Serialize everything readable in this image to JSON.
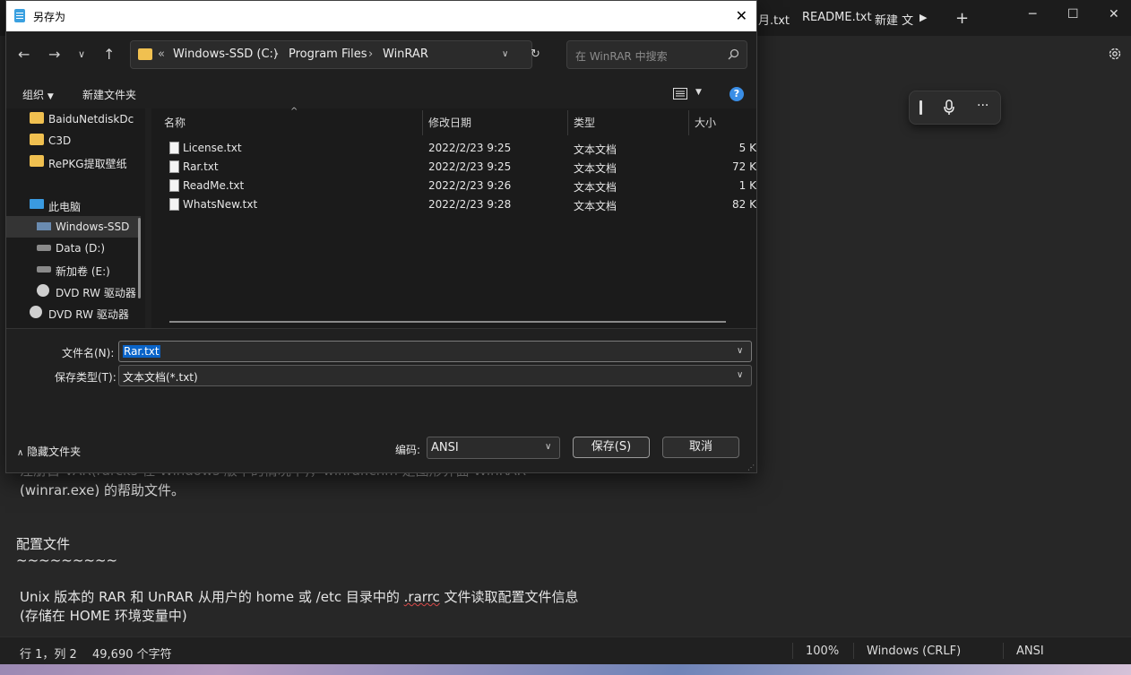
{
  "notepad": {
    "tabs": [
      "月.txt",
      "README.txt",
      "新建 文"
    ],
    "content": {
      "line1": "注册自 VAR(rarcks 在 Windows 版中的情况下)，winrar.chm 是图形界面 WinRAR",
      "line2": "(winrar.exe) 的帮助文件。",
      "heading": "配置文件",
      "tildes": "~~~~~~~~~",
      "line3a": "Unix 版本的 RAR 和 UnRAR 从用户的 home 或 /etc 目录中的 ",
      "line3b": ".rarrc",
      "line3c": " 文件读取配置文件信息",
      "line4": "(存储在 HOME 环境变量中)"
    },
    "status": {
      "position": "行 1，列 2",
      "chars": "49,690 个字符",
      "zoom": "100%",
      "line_ending": "Windows (CRLF)",
      "encoding": "ANSI"
    }
  },
  "dialog": {
    "title": "另存为",
    "breadcrumb": {
      "overflow": "«",
      "parts": [
        "Windows-SSD (C:)",
        "Program Files",
        "WinRAR"
      ]
    },
    "search_placeholder": "在 WinRAR 中搜索",
    "toolbar": {
      "organize": "组织",
      "new_folder": "新建文件夹"
    },
    "tree": [
      {
        "label": "BaiduNetdiskDc",
        "icon": "folder-icon"
      },
      {
        "label": "C3D",
        "icon": "folder-icon"
      },
      {
        "label": "RePKG提取壁纸",
        "icon": "folder-icon"
      },
      {
        "label": "此电脑",
        "icon": "computer-icon"
      },
      {
        "label": "Windows-SSD",
        "icon": "drive-icon"
      },
      {
        "label": "Data (D:)",
        "icon": "drive-icon"
      },
      {
        "label": "新加卷 (E:)",
        "icon": "drive-icon"
      },
      {
        "label": "DVD RW 驱动器",
        "icon": "dvd-icon"
      },
      {
        "label": "DVD RW 驱动器",
        "icon": "dvd-icon"
      }
    ],
    "columns": {
      "name": "名称",
      "modified": "修改日期",
      "type": "类型",
      "size": "大小"
    },
    "files": [
      {
        "name": "License.txt",
        "modified": "2022/2/23 9:25",
        "type": "文本文档",
        "size": "5 K"
      },
      {
        "name": "Rar.txt",
        "modified": "2022/2/23 9:25",
        "type": "文本文档",
        "size": "72 K"
      },
      {
        "name": "ReadMe.txt",
        "modified": "2022/2/23 9:26",
        "type": "文本文档",
        "size": "1 K"
      },
      {
        "name": "WhatsNew.txt",
        "modified": "2022/2/23 9:28",
        "type": "文本文档",
        "size": "82 K"
      }
    ],
    "filename_label": "文件名(N):",
    "filename_value": "Rar.txt",
    "filetype_label": "保存类型(T):",
    "filetype_value": "文本文档(*.txt)",
    "hide_folders": "隐藏文件夹",
    "encoding_label": "编码:",
    "encoding_value": "ANSI",
    "save_button": "保存(S)",
    "cancel_button": "取消"
  }
}
